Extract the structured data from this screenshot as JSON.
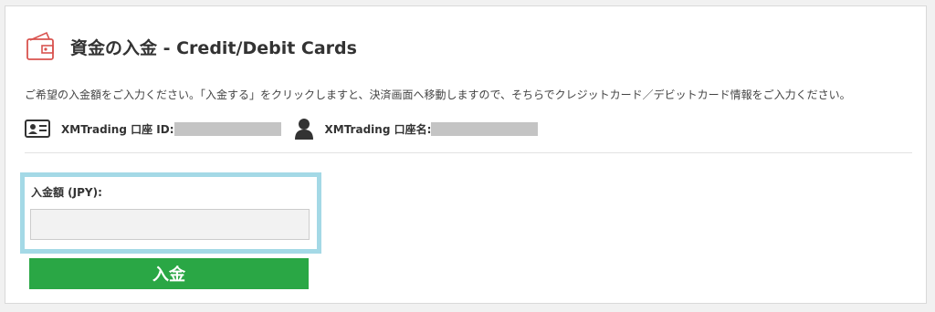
{
  "header": {
    "title": "資金の入金 - Credit/Debit Cards",
    "icon": "wallet-icon",
    "icon_color": "#d9534f"
  },
  "description": "ご希望の入金額をご入力ください。「入金する」をクリックしますと、決済画面へ移動しますので、そちらでクレジットカード／デビットカード情報をご入力ください。",
  "account": {
    "id_label": "XMTrading 口座 ID:",
    "id_icon": "id-card-icon",
    "name_label": "XMTrading 口座名:",
    "name_icon": "user-icon"
  },
  "form": {
    "amount_label": "入金額 (JPY):",
    "amount_value": "",
    "amount_placeholder": "",
    "highlight_color": "#a4d9e6"
  },
  "submit": {
    "label": "入金",
    "color": "#2aa745"
  }
}
